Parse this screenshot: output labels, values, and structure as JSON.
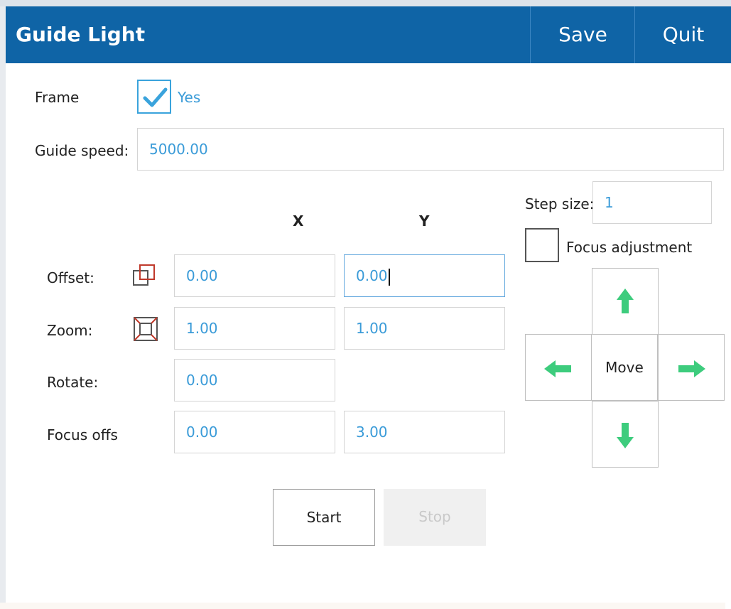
{
  "header": {
    "title": "Guide Light",
    "save_label": "Save",
    "quit_label": "Quit"
  },
  "frame": {
    "label": "Frame",
    "checked": true,
    "option_label": "Yes"
  },
  "guide_speed": {
    "label": "Guide speed:",
    "value": "5000.00"
  },
  "columns": {
    "x": "X",
    "y": "Y"
  },
  "rows": {
    "offset": {
      "label": "Offset:",
      "x": "0.00",
      "y": "0.00",
      "icon": "offset-icon"
    },
    "zoom": {
      "label": "Zoom:",
      "x": "1.00",
      "y": "1.00",
      "icon": "zoom-icon"
    },
    "rotate": {
      "label": "Rotate:",
      "x": "0.00"
    },
    "focus_offset": {
      "label": "Focus offs",
      "x": "0.00",
      "y": "3.00"
    }
  },
  "step_size": {
    "label": "Step size:",
    "value": "1"
  },
  "focus_adjustment": {
    "label": "Focus adjustment",
    "checked": false
  },
  "move": {
    "label": "Move",
    "arrow_color": "#3dcc7d"
  },
  "actions": {
    "start_label": "Start",
    "stop_label": "Stop",
    "stop_enabled": false
  },
  "colors": {
    "header": "#0f64a6",
    "value_text": "#3a9bd8",
    "checkbox_accent": "#3aa3dc",
    "icon_red": "#c0392b"
  }
}
